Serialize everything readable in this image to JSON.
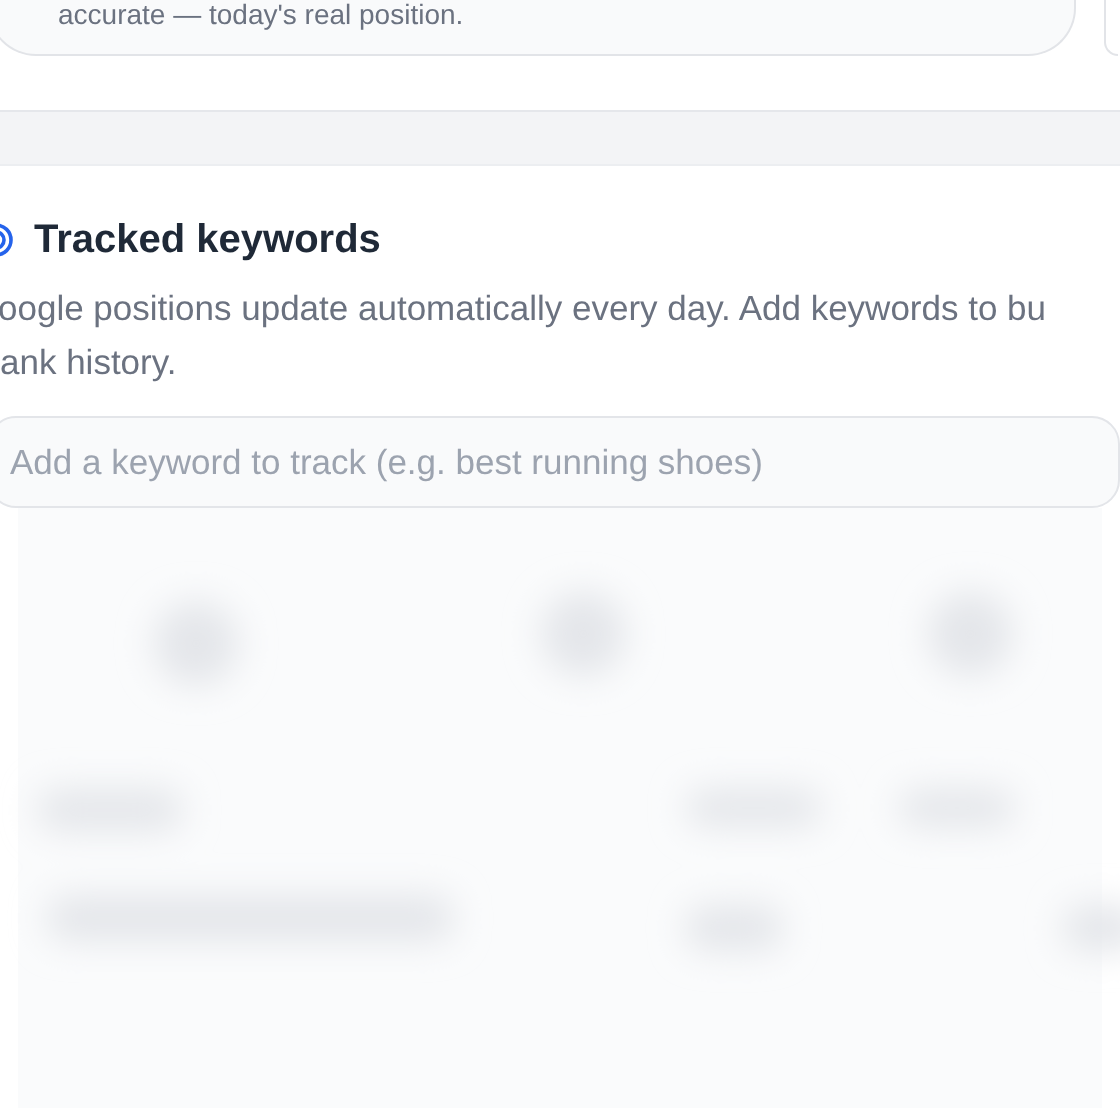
{
  "top_card": {
    "note": "accurate — today's real position."
  },
  "section": {
    "title": "Tracked keywords",
    "description_lines": [
      "oogle positions update automatically every day. Add keywords to bu",
      "ank history."
    ],
    "keyword_input": {
      "placeholder": "Add a keyword to track (e.g. best running shoes)"
    }
  }
}
